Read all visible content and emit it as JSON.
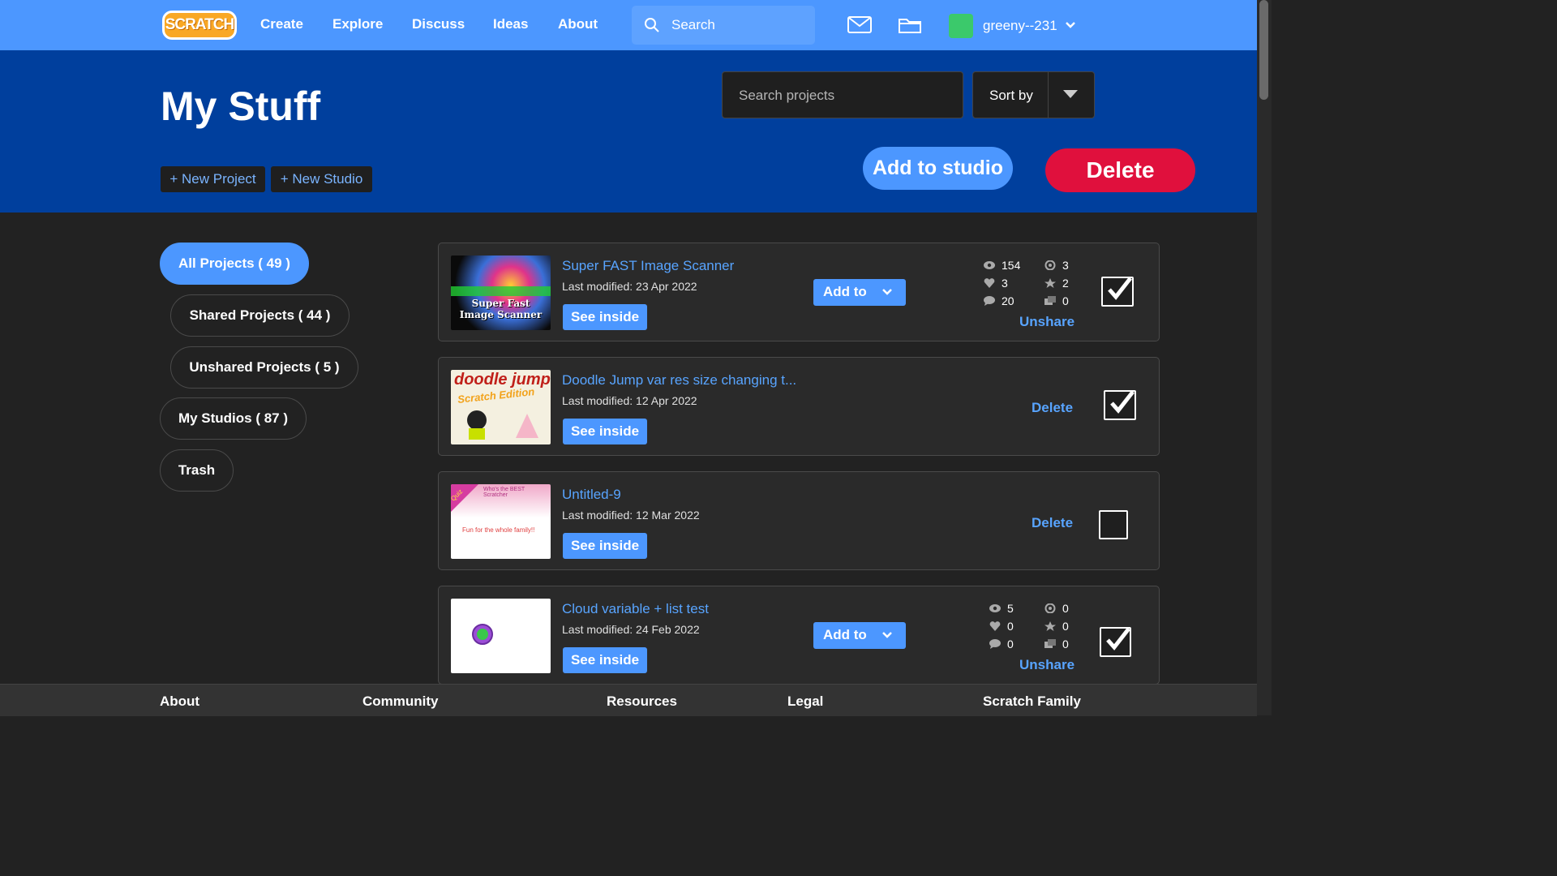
{
  "header": {
    "logo": "SCRATCH",
    "nav": [
      "Create",
      "Explore",
      "Discuss",
      "Ideas",
      "About"
    ],
    "search_placeholder": "Search",
    "username": "greeny--231"
  },
  "banner": {
    "title": "My Stuff",
    "new_project": "+ New Project",
    "new_studio": "+ New Studio",
    "search_projects_placeholder": "Search projects",
    "sort_by": "Sort by",
    "add_to_studio": "Add to studio",
    "delete": "Delete"
  },
  "sidebar": {
    "items": [
      {
        "label": "All Projects ( 49 )",
        "active": true
      },
      {
        "label": "Shared Projects ( 44 )",
        "active": false
      },
      {
        "label": "Unshared Projects ( 5 )",
        "active": false
      },
      {
        "label": "My Studios ( 87 )",
        "active": false
      },
      {
        "label": "Trash",
        "active": false
      }
    ]
  },
  "projects": [
    {
      "title": "Super FAST Image Scanner",
      "modified": "Last modified: 23 Apr 2022",
      "see_inside": "See inside",
      "add_to": "Add to",
      "thumb_text": "Super Fast Image Scanner",
      "stats": {
        "views": "154",
        "loves": "3",
        "comments": "20",
        "remixes": "3",
        "favorites": "2",
        "studios": "0"
      },
      "action": "Unshare",
      "checked": true
    },
    {
      "title": "Doodle Jump var res size changing t...",
      "modified": "Last modified: 12 Apr 2022",
      "see_inside": "See inside",
      "thumb_text": "doodle jump",
      "thumb_sub": "Scratch Edition",
      "action": "Delete",
      "checked": true
    },
    {
      "title": "Untitled-9",
      "modified": "Last modified: 12 Mar 2022",
      "see_inside": "See inside",
      "thumb_text": "Fun for the whole family!!",
      "thumb_corner": "Quiz",
      "thumb_top": "Who's the BEST Scratcher",
      "action": "Delete",
      "checked": false
    },
    {
      "title": "Cloud variable + list test",
      "modified": "Last modified: 24 Feb 2022",
      "see_inside": "See inside",
      "add_to": "Add to",
      "stats": {
        "views": "5",
        "loves": "0",
        "comments": "0",
        "remixes": "0",
        "favorites": "0",
        "studios": "0"
      },
      "action": "Unshare",
      "checked": true
    }
  ],
  "footer": [
    "About",
    "Community",
    "Resources",
    "Legal",
    "Scratch Family"
  ],
  "colors": {
    "accent": "#4c97ff",
    "banner": "#003f9d",
    "danger": "#e0103d",
    "bg": "#222222"
  }
}
